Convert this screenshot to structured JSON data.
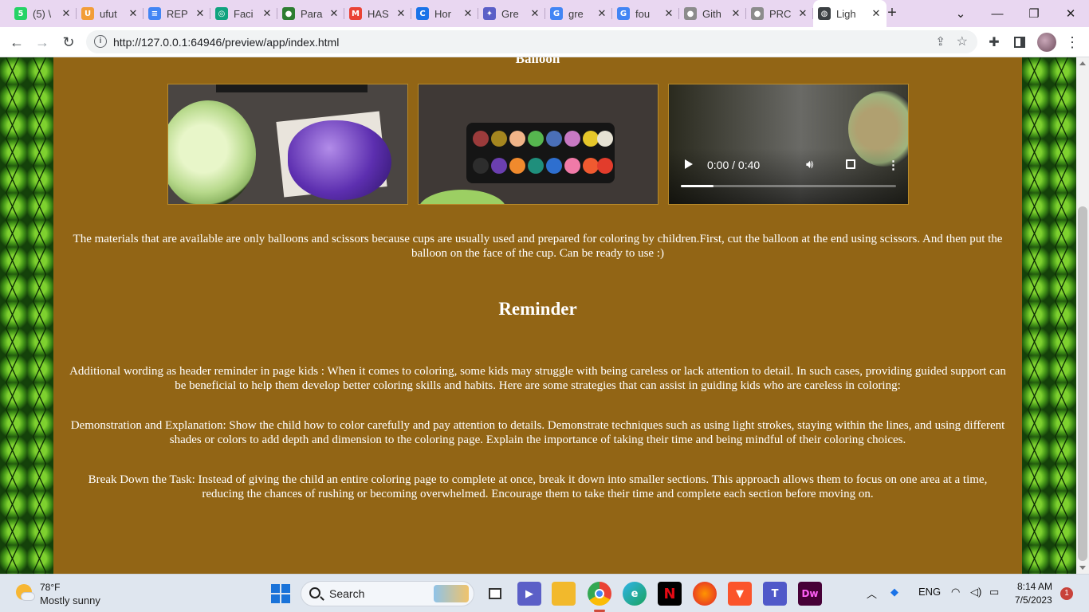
{
  "browser": {
    "tabs": [
      {
        "label": "(5) \\",
        "icon": "whatsapp-icon",
        "color": "#25d366",
        "glyph": "5"
      },
      {
        "label": "ufut",
        "icon": "brand-u-icon",
        "color": "#f29d38",
        "glyph": "U"
      },
      {
        "label": "REP",
        "icon": "google-docs-icon",
        "color": "#4285f4",
        "glyph": "≡"
      },
      {
        "label": "Faci",
        "icon": "openai-icon",
        "color": "#10a37f",
        "glyph": "◎"
      },
      {
        "label": "Para",
        "icon": "android-icon",
        "color": "#2e7d32",
        "glyph": "●"
      },
      {
        "label": "HAS",
        "icon": "gmail-icon",
        "color": "#ea4335",
        "glyph": "M"
      },
      {
        "label": "Hor",
        "icon": "brand-c-icon",
        "color": "#1a73e8",
        "glyph": "C"
      },
      {
        "label": "Gre",
        "icon": "chat-bubble-icon",
        "color": "#5b5fc7",
        "glyph": "✦"
      },
      {
        "label": "gre",
        "icon": "google-icon",
        "color": "#4285f4",
        "glyph": "G"
      },
      {
        "label": "fou",
        "icon": "google-icon",
        "color": "#4285f4",
        "glyph": "G"
      },
      {
        "label": "Gith",
        "icon": "github-icon",
        "color": "#8c8c8c",
        "glyph": "●"
      },
      {
        "label": "PRC",
        "icon": "github-icon",
        "color": "#8c8c8c",
        "glyph": "●"
      },
      {
        "label": "Ligh",
        "icon": "globe-icon",
        "color": "#3c4043",
        "glyph": "◍",
        "active": true
      }
    ],
    "url": "http://127.0.0.1:64946/preview/app/index.html"
  },
  "page": {
    "balloon_heading": "Balloon",
    "video": {
      "time": "0:00 / 0:40",
      "progress": 0.15
    },
    "materials_text": "The materials that are available are only balloons and scissors because cups are usually used and prepared for coloring by children.First, cut the balloon at the end using scissors. And then put the balloon on the face of the cup. Can be ready to use :)",
    "reminder_heading": "Reminder",
    "paragraphs": [
      "Additional wording as header reminder in page kids : When it comes to coloring, some kids may struggle with being careless or lack attention to detail. In such cases, providing guided support can be beneficial to help them develop better coloring skills and habits. Here are some strategies that can assist in guiding kids who are careless in coloring:",
      "Demonstration and Explanation: Show the child how to color carefully and pay attention to details. Demonstrate techniques such as using light strokes, staying within the lines, and using different shades or colors to add depth and dimension to the coloring page. Explain the importance of taking their time and being mindful of their coloring choices.",
      "Break Down the Task: Instead of giving the child an entire coloring page to complete at once, break it down into smaller sections. This approach allows them to focus on one area at a time, reducing the chances of rushing or becoming overwhelmed. Encourage them to take their time and complete each section before moving on."
    ],
    "colors": {
      "content_bg": "#926515",
      "text": "#ffffff"
    }
  },
  "taskbar": {
    "weather_temp": "78°F",
    "weather_desc": "Mostly sunny",
    "search_label": "Search",
    "language": "ENG",
    "time": "8:14 AM",
    "date": "7/5/2023",
    "notifications": "1",
    "dw_label": "Dw"
  }
}
